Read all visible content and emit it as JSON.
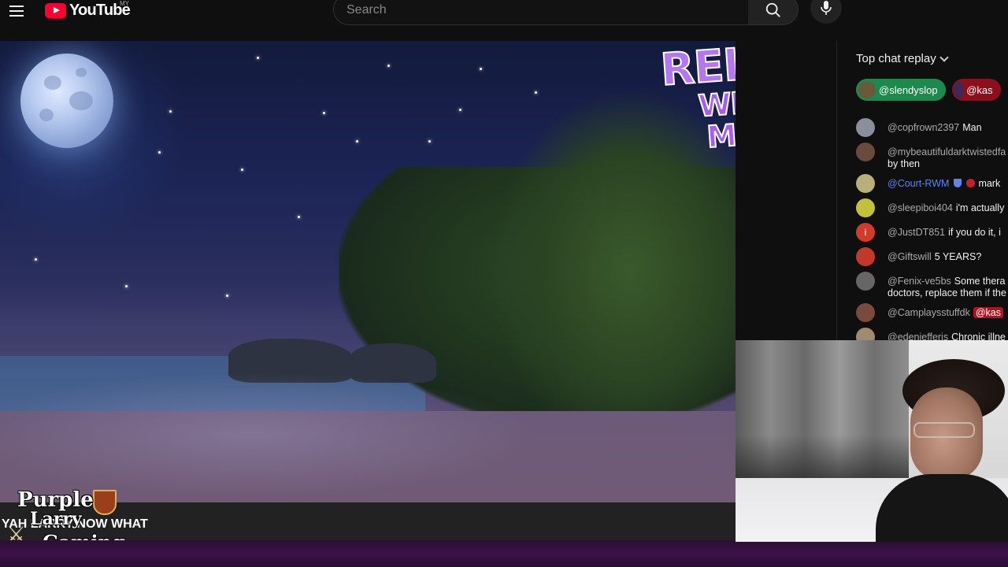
{
  "app": {
    "name": "YouTube",
    "logo_sup": "MY"
  },
  "search": {
    "placeholder": "Search"
  },
  "video": {
    "overlay_logo": {
      "line1": "RELAX",
      "line2": "WITH MAX"
    },
    "subtitle": "YAH LARRY NOW WHAT",
    "streamer_logo": {
      "line1": "Purple",
      "line2": "Larry",
      "line3": "Gaming"
    }
  },
  "chat": {
    "header": "Top chat replay",
    "pinned": [
      {
        "name": "@slendyslop",
        "color": "#1b8a4c"
      },
      {
        "name": "@kas",
        "color": "#8c0f1b"
      }
    ],
    "messages": [
      {
        "author": "@copfrown2397",
        "text": "Man",
        "avatar_color": "#8a8f99"
      },
      {
        "author": "@mybeautifuldarktwistedfa",
        "text": "by then",
        "avatar_color": "#6a4a3a"
      },
      {
        "author": "@Court-RWM",
        "text": "mark",
        "avatar_color": "#b7b078",
        "moderator": true
      },
      {
        "author": "@sleepiboi404",
        "text": "i'm actually",
        "avatar_color": "#c2c23a"
      },
      {
        "author": "@JustDT851",
        "text": "if you do it, i",
        "avatar_color": "#d23a2a",
        "avatar_letter": "i"
      },
      {
        "author": "@Giftswill",
        "text": "5 YEARS?",
        "avatar_color": "#c0392b"
      },
      {
        "author": "@Fenix-ve5bs",
        "text": "Some thera",
        "text2": "doctors, replace them if the",
        "avatar_color": "#666666"
      },
      {
        "author": "@Camplaysstuffdk",
        "mention": "@kas",
        "avatar_color": "#7a4a3a"
      },
      {
        "author": "@edenjefferis",
        "text": "Chronic illne",
        "avatar_color": "#a08a70"
      }
    ]
  },
  "colors": {
    "accent": "#ff0033",
    "chat_mention": "#b0121f",
    "moderator": "#5e84f1"
  }
}
